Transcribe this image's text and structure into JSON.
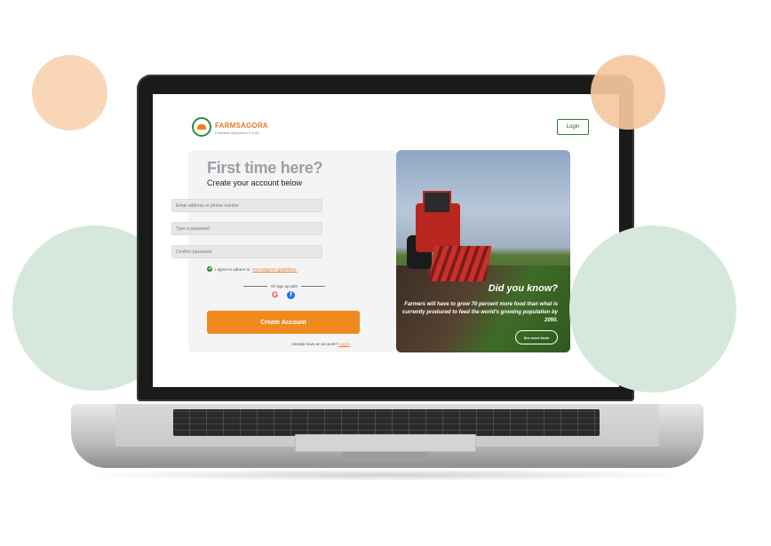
{
  "header": {
    "brand_name": "FARMSAGORA",
    "brand_tagline": "Profitable Agriculture For All",
    "login_label": "Login"
  },
  "form": {
    "title": "First time here?",
    "subtitle": "Create your account below",
    "email_placeholder": "Email address or phone number",
    "password_placeholder": "Type a password",
    "confirm_placeholder": "Confirm password",
    "agree_text": "I agree to adhere to",
    "agree_link": "Farmsagora's guidelines.",
    "or_sign_up": "Or sign up with",
    "create_button": "Create Account",
    "already_text": "Already have an account?",
    "login_link": "Log in"
  },
  "social": {
    "google_glyph": "G",
    "facebook_glyph": "f"
  },
  "promo": {
    "heading": "Did you know?",
    "body": "Farmers will have to grow 70 percent more food than what is currently produced to feed the world's growing population by 2050.",
    "see_more": "See more facts"
  },
  "colors": {
    "brand_orange": "#f08a1e",
    "brand_green": "#2e7d32",
    "circle_orange": "#f8d6b7",
    "circle_green": "#d6e8dc"
  },
  "icons": [
    "check-icon",
    "google-icon",
    "facebook-icon",
    "logo-icon"
  ]
}
